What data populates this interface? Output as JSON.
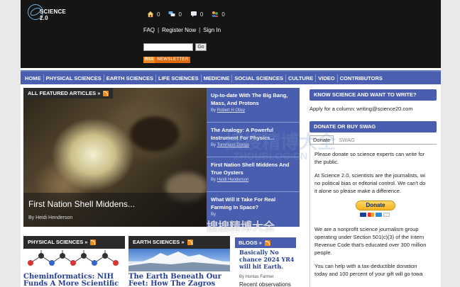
{
  "site": {
    "logo_text": "SCIENCE 2.0"
  },
  "header": {
    "icon_counts": [
      "0",
      "0",
      "0",
      "0"
    ],
    "account_links": [
      "FAQ",
      "Register Now",
      "Sign In"
    ],
    "search_button": "Go",
    "newsletter": {
      "rss": "RSS",
      "label": "NEWSLETTER"
    }
  },
  "nav": [
    "HOME",
    "PHYSICAL SCIENCES",
    "EARTH SCIENCES",
    "LIFE SCIENCES",
    "MEDICINE",
    "SOCIAL SCIENCES",
    "CULTURE",
    "VIDEO",
    "CONTRIBUTORS"
  ],
  "featured": {
    "label": "ALL FEATURED ARTICLES »",
    "title": "First Nation Shell Middens...",
    "author": "By Heidi Henderson"
  },
  "side_stories": [
    {
      "title": "Up-to-date With The Big Bang, Mass, And Protons",
      "by": "By",
      "author": "Robert H Olley"
    },
    {
      "title": "The Analogy: A Powerful Instrument For Physics...",
      "by": "By",
      "author": "Tommaso Dorigo"
    },
    {
      "title": "First Nation Shell Middens And True Oysters",
      "by": "By",
      "author": "Heidi Henderson"
    },
    {
      "title": "What Will It Take For Real Farming In Space?",
      "by": "By",
      "author": ""
    }
  ],
  "write": {
    "heading": "KNOW SCIENCE AND WANT TO WRITE?",
    "text": "Apply for a column: writing@science20.com"
  },
  "donate": {
    "heading": "DONATE OR BUY SWAG",
    "tabs": [
      "Donate",
      "SWAG"
    ],
    "para1": [
      "Please donate so science experts can write for",
      "the public."
    ],
    "para2": [
      "At Science 2.0, scientists are the journalists, wi",
      "no political bias or editorial control. We can't do",
      "it alone so please make a difference."
    ],
    "button": "Donate",
    "para3": [
      "We are a nonprofit science journalism group",
      "operating under Section 501(c)(3) of the Intern",
      "Revenue Code that's educated over 300 million",
      "people."
    ],
    "para4": [
      "You can help with a tax-deductible donation",
      "today and 100 percent of your gift will go towa"
    ]
  },
  "sections": {
    "physical": {
      "label": "PHYSICAL SCIENCES »",
      "title": "Cheminformatics: NIH",
      "title2": "Funds A More Scientific"
    },
    "earth": {
      "label": "EARTH SCIENCES »",
      "title": "The Earth Beneath Our",
      "title2": "Feet: How The Zagros"
    },
    "blogs": {
      "label": "BLOGS »",
      "title": "Basically No chance 2024 YR4 will hit Earth.",
      "author": "By Hontas Farmer",
      "snippet": "Recent observations"
    }
  },
  "colors": {
    "header_bg": "#151515",
    "nav_bg": "#4b5fb0",
    "accent_blue": "#4a5eaf",
    "link_blue": "#253d92",
    "rss_orange": "#f08a1c"
  },
  "watermark": {
    "cn": "搜搜精博大全",
    "en": "ZHOUBLOG.CN"
  }
}
